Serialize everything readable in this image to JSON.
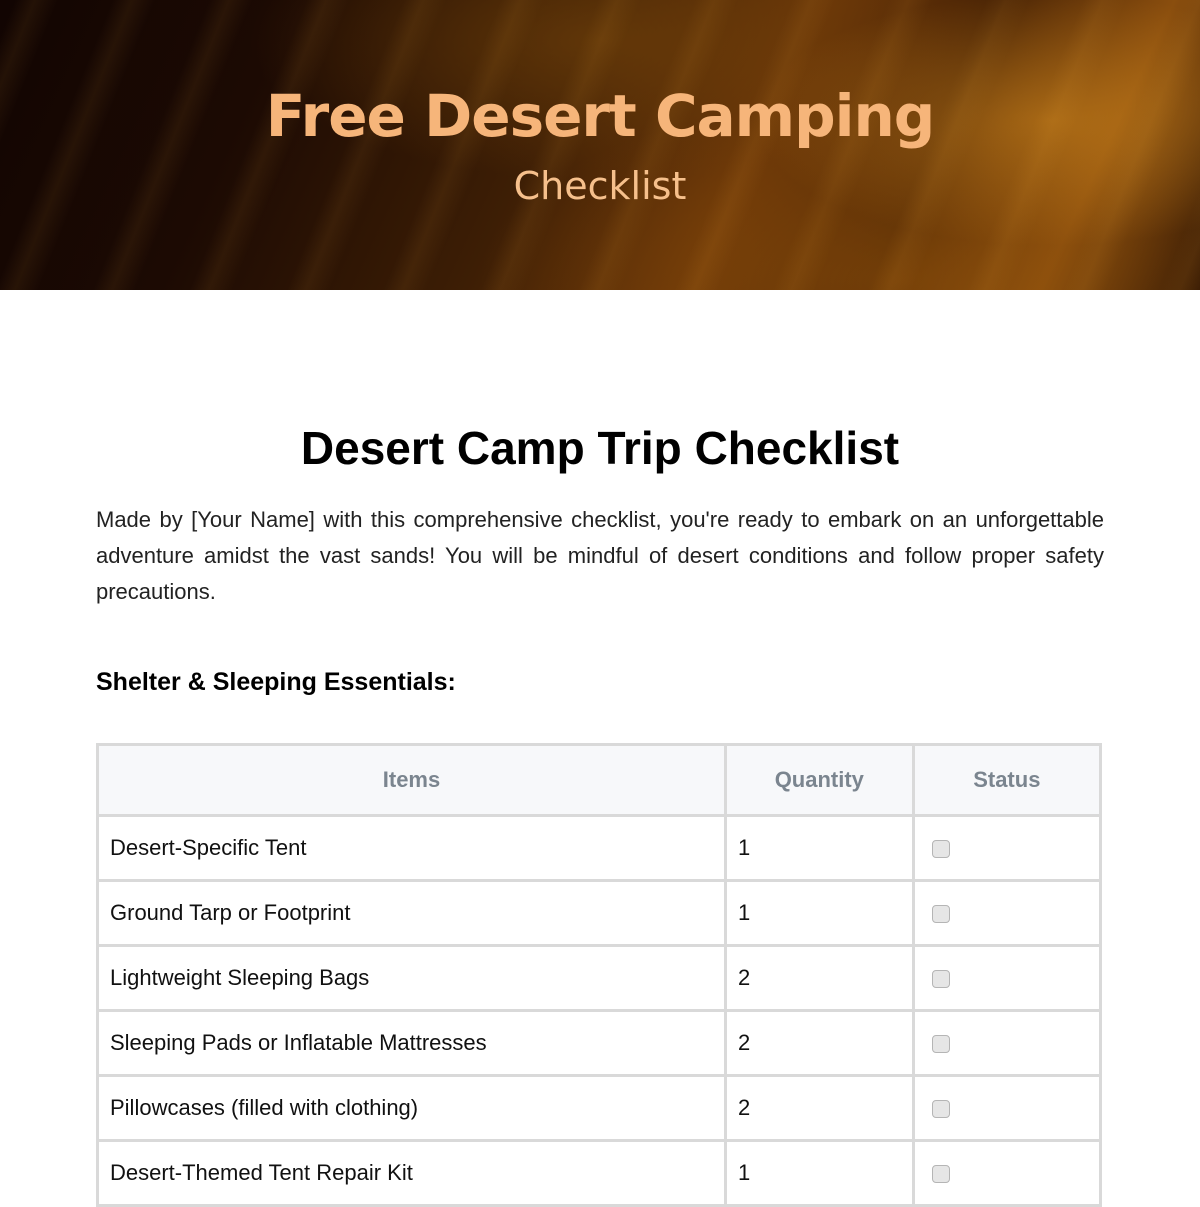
{
  "banner": {
    "title": "Free Desert Camping",
    "subtitle": "Checklist",
    "title_color": "#f6b57a"
  },
  "document": {
    "title": "Desert Camp Trip Checklist",
    "intro": "Made by [Your Name] with this comprehensive checklist, you're ready to embark on an unforgettable adventure amidst the vast sands! You will be mindful of desert conditions and follow proper safety precautions.",
    "section_title": "Shelter & Sleeping Essentials:"
  },
  "table": {
    "headers": [
      "Items",
      "Quantity",
      "Status"
    ],
    "rows": [
      {
        "item": "Desert-Specific Tent",
        "quantity": "1",
        "checked": false
      },
      {
        "item": "Ground Tarp or Footprint",
        "quantity": "1",
        "checked": false
      },
      {
        "item": "Lightweight Sleeping Bags",
        "quantity": "2",
        "checked": false
      },
      {
        "item": "Sleeping Pads or Inflatable Mattresses",
        "quantity": "2",
        "checked": false
      },
      {
        "item": "Pillowcases (filled with clothing)",
        "quantity": "2",
        "checked": false
      },
      {
        "item": "Desert-Themed Tent Repair Kit",
        "quantity": "1",
        "checked": false
      }
    ]
  }
}
